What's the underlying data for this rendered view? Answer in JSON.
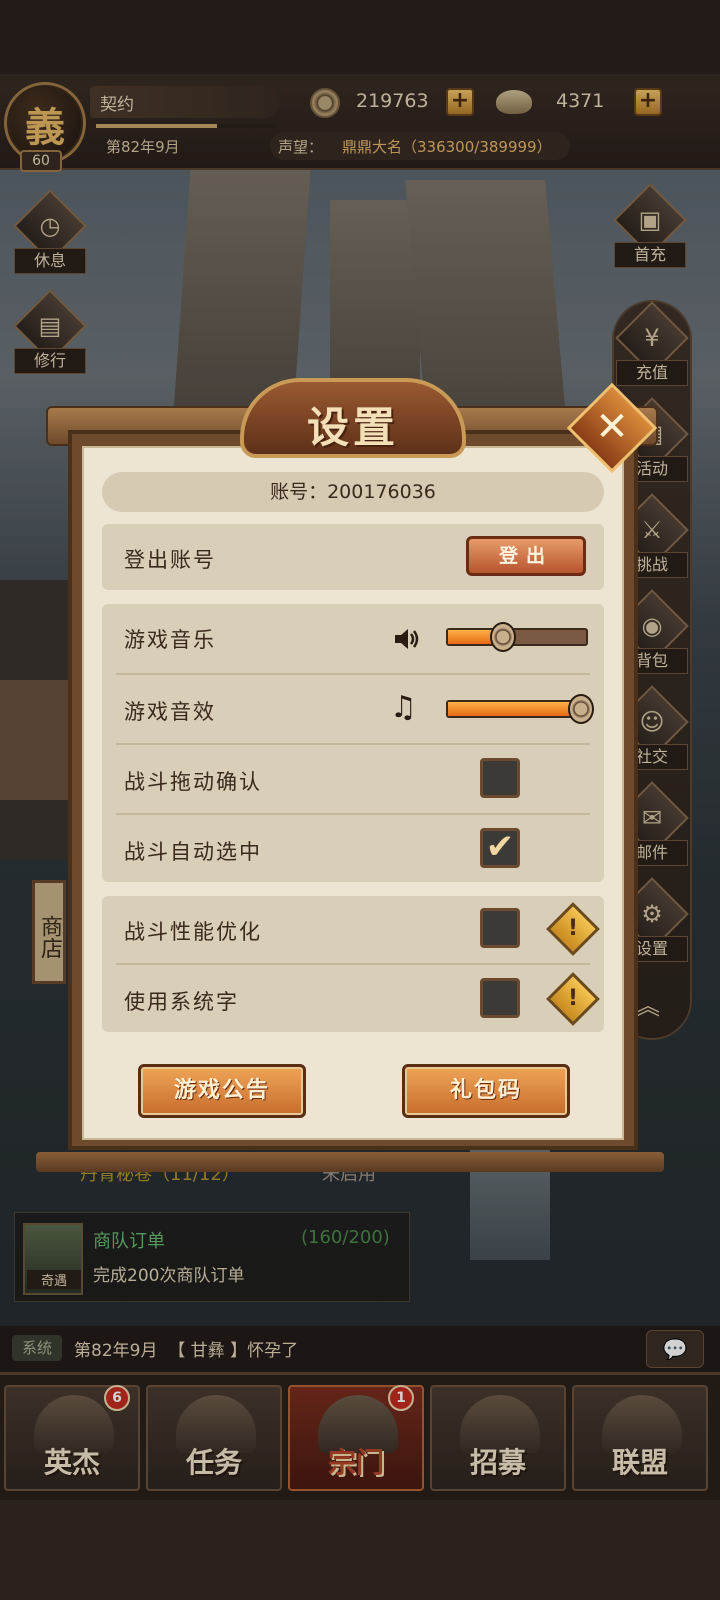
{
  "player": {
    "badge_glyph": "義",
    "level": "60",
    "name": "契约",
    "date": "第82年9月",
    "fame_label": "声望：",
    "fame_value": "鼎鼎大名（336300/389999）",
    "exp_progress": 0.67
  },
  "currency": {
    "coins": "219763",
    "ingots": "4371",
    "plus": "+"
  },
  "left_side": [
    {
      "label": "休息",
      "icon": "clock-icon"
    },
    {
      "label": "修行",
      "icon": "book-icon"
    }
  ],
  "right_side": [
    {
      "label": "首充",
      "icon": "gift-icon"
    },
    {
      "label": "充值",
      "icon": "yuan-icon"
    },
    {
      "label": "活动",
      "icon": "calendar-icon"
    },
    {
      "label": "挑战",
      "icon": "swords-icon"
    },
    {
      "label": "背包",
      "icon": "bag-icon"
    },
    {
      "label": "社交",
      "icon": "people-icon"
    },
    {
      "label": "邮件",
      "icon": "mail-icon"
    },
    {
      "label": "设置",
      "icon": "gear-icon"
    }
  ],
  "shop_label": "商店",
  "quests": {
    "scroll_title": "丹青秘卷（11/12）",
    "scroll_state": "未启用",
    "caravan_title": "商队订单",
    "caravan_progress": "(160/200)",
    "caravan_desc": "完成200次商队订单",
    "caravan_tag": "奇遇"
  },
  "system_message": {
    "tag": "系统",
    "text": "第82年9月  【 甘彝 】怀孕了"
  },
  "bottom_nav": [
    {
      "label": "英杰",
      "badge": "6",
      "active": false
    },
    {
      "label": "任务",
      "badge": "",
      "active": false
    },
    {
      "label": "宗门",
      "badge": "1",
      "active": true
    },
    {
      "label": "招募",
      "badge": "",
      "active": false
    },
    {
      "label": "联盟",
      "badge": "",
      "active": false
    }
  ],
  "settings": {
    "title": "设置",
    "close": "✕",
    "account_label": "账号：200176036",
    "logout_row": "登出账号",
    "logout_button": "登出",
    "music_label": "游戏音乐",
    "music_volume": 0.4,
    "sfx_label": "游戏音效",
    "sfx_volume": 1.0,
    "battle_drag_label": "战斗拖动确认",
    "battle_drag_checked": false,
    "battle_auto_label": "战斗自动选中",
    "battle_auto_checked": true,
    "perf_label": "战斗性能优化",
    "perf_checked": false,
    "sysfont_label": "使用系统字",
    "sysfont_checked": false,
    "warn_glyph": "!",
    "check_glyph": "✔",
    "notice_button": "游戏公告",
    "gift_code_button": "礼包码"
  }
}
